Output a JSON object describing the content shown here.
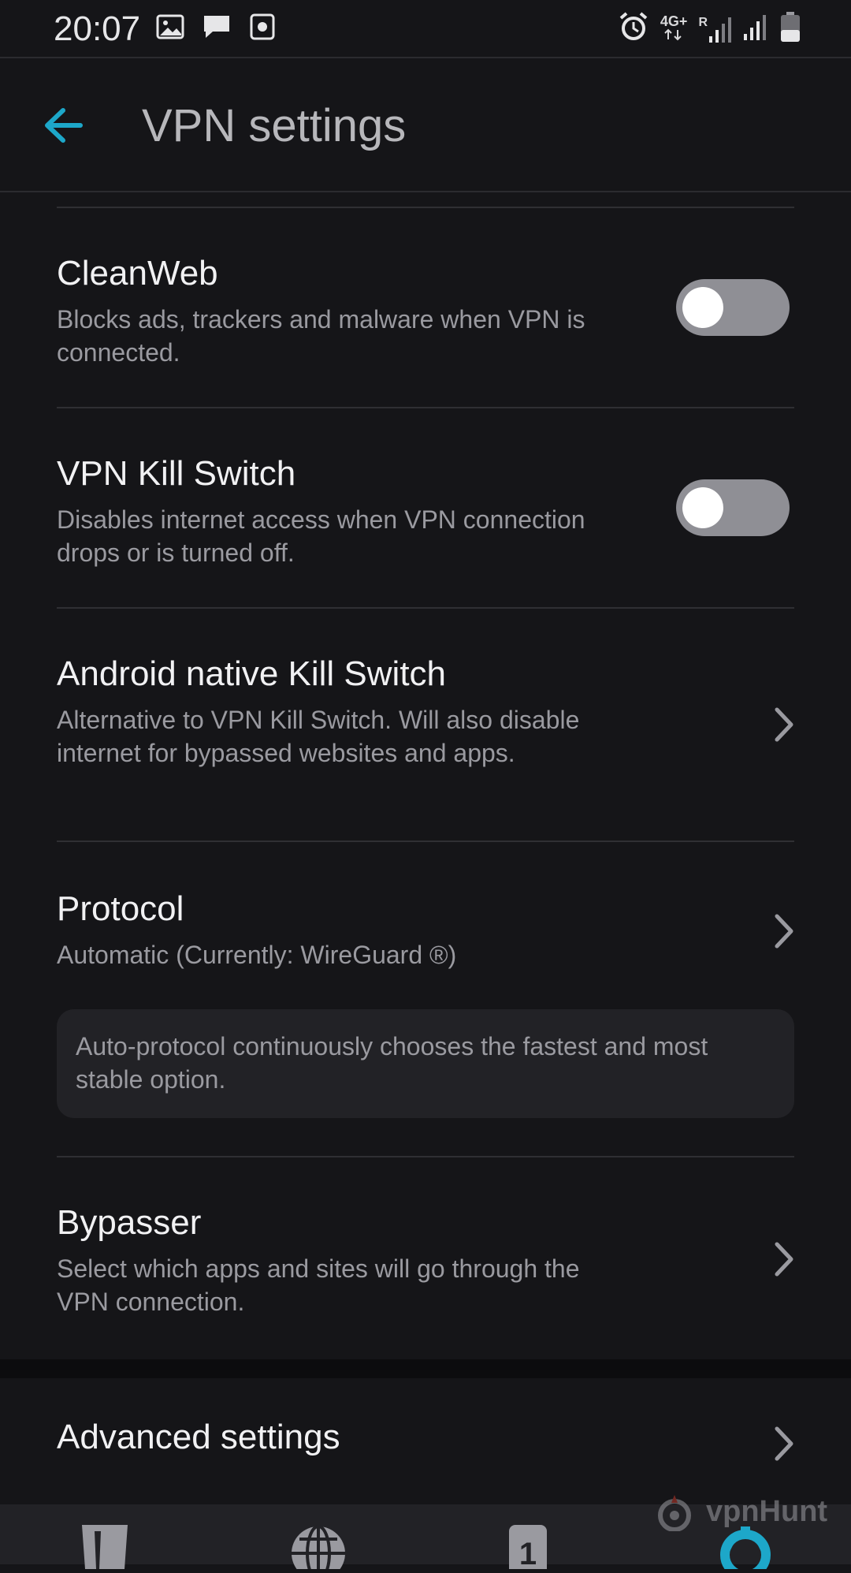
{
  "status_bar": {
    "time": "20:07",
    "left_icons": [
      "image-icon",
      "message-icon",
      "screen-record-icon"
    ],
    "network_type": "4G+",
    "roaming": "R",
    "right_icons": [
      "alarm-icon",
      "signal-icon",
      "signal-icon",
      "battery-icon"
    ]
  },
  "header": {
    "title": "VPN settings",
    "back_icon": "arrow-left-icon",
    "accent_color": "#1da7c9"
  },
  "settings": {
    "cleanweb": {
      "title": "CleanWeb",
      "description": "Blocks ads, trackers and malware when VPN is connected.",
      "enabled": false
    },
    "kill_switch": {
      "title": "VPN Kill Switch",
      "description": "Disables internet access when VPN connection drops or is turned off.",
      "enabled": false
    },
    "native_kill_switch": {
      "title": "Android native Kill Switch",
      "description": "Alternative to VPN Kill Switch. Will also disable internet for bypassed websites and apps."
    },
    "protocol": {
      "title": "Protocol",
      "description": "Automatic (Currently: WireGuard ®)",
      "info": "Auto-protocol continuously chooses the fastest and most stable option."
    },
    "bypasser": {
      "title": "Bypasser",
      "description": "Select which apps and sites will go through the VPN connection."
    },
    "advanced": {
      "title": "Advanced settings"
    }
  },
  "bottom_nav": {
    "items": [
      "shield-icon",
      "globe-icon",
      "one-icon",
      "gear-icon"
    ],
    "one_label": "1",
    "active": "gear-icon"
  },
  "watermark": {
    "text": "vpnHunt"
  }
}
